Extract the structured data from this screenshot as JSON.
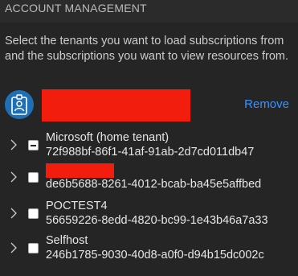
{
  "header": {
    "title": "ACCOUNT MANAGEMENT"
  },
  "description": "Select the tenants you want to load subscriptions from and the subscriptions you want to view resources from.",
  "account": {
    "remove_label": "Remove",
    "avatar_icon": "badge-person-icon",
    "accent_color": "#1f6fb5",
    "link_color": "#3794ff",
    "redaction_color": "#f21d0c"
  },
  "tenants": [
    {
      "name": "Microsoft (home tenant)",
      "id": "72f988bf-86f1-41af-91ab-2d7cd011db47",
      "checked": "indeterminate"
    },
    {
      "name": "",
      "id": "de6b5688-8261-4012-bcab-ba45e5affbed",
      "checked": "unchecked"
    },
    {
      "name": "POCTEST4",
      "id": "56659226-8edd-4820-bc99-1e43b46a7a33",
      "checked": "unchecked"
    },
    {
      "name": "Selfhost",
      "id": "246b1785-9030-40d8-a0f0-d94b15dc002c",
      "checked": "unchecked"
    }
  ]
}
